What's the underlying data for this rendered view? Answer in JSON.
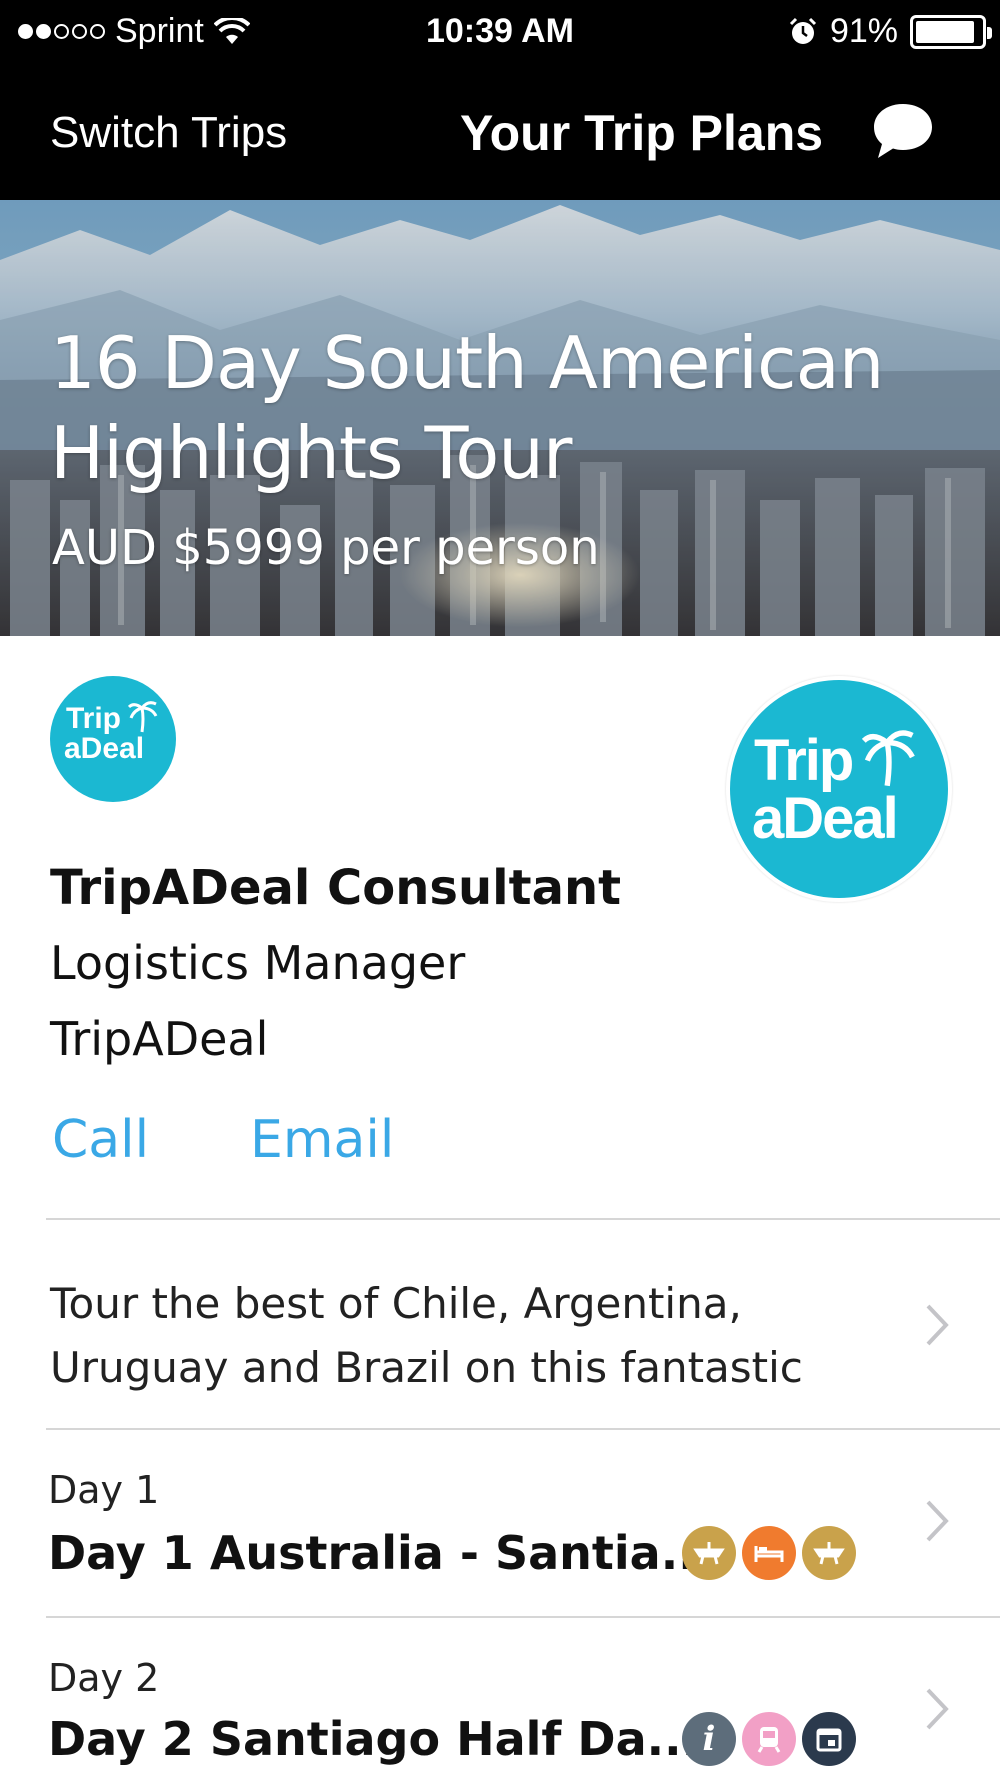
{
  "status_bar": {
    "carrier": "Sprint",
    "time": "10:39 AM",
    "battery": "91%",
    "battery_level": 0.91,
    "signal_bars": 2,
    "icons": [
      "wifi-icon",
      "alarm-icon",
      "battery-icon"
    ]
  },
  "nav": {
    "left_label": "Switch Trips",
    "title": "Your Trip Plans",
    "right_icon": "chat-bubble-icon"
  },
  "hero": {
    "title_line1": "16 Day South American",
    "title_line2": "Highlights Tour",
    "price": "AUD $5999 per person"
  },
  "consultant": {
    "logo_line1": "Trip",
    "logo_line2": "aDeal",
    "name": "TripADeal Consultant",
    "role": "Logistics Manager",
    "company": "TripADeal",
    "call_label": "Call",
    "email_label": "Email"
  },
  "description": {
    "line1": "Tour the best of Chile, Argentina,",
    "line2": "Uruguay and Brazil on this fantastic"
  },
  "days": [
    {
      "label": "Day 1",
      "title": "Day 1 Australia - Santia...",
      "badges": [
        {
          "icon": "flight-icon",
          "color": "#c9a24b"
        },
        {
          "icon": "hotel-bed-icon",
          "color": "#f07b2e"
        },
        {
          "icon": "flight-icon",
          "color": "#c9a24b"
        }
      ]
    },
    {
      "label": "Day 2",
      "title": "Day 2 Santiago Half Da...",
      "badges": [
        {
          "icon": "info-icon",
          "color": "#5d6d7b"
        },
        {
          "icon": "train-icon",
          "color": "#f2a0c6"
        },
        {
          "icon": "calendar-icon",
          "color": "#2b3a4d"
        }
      ]
    }
  ],
  "colors": {
    "accent": "#3aa8e6",
    "brand": "#1bb8d2",
    "bar": "#000000"
  }
}
